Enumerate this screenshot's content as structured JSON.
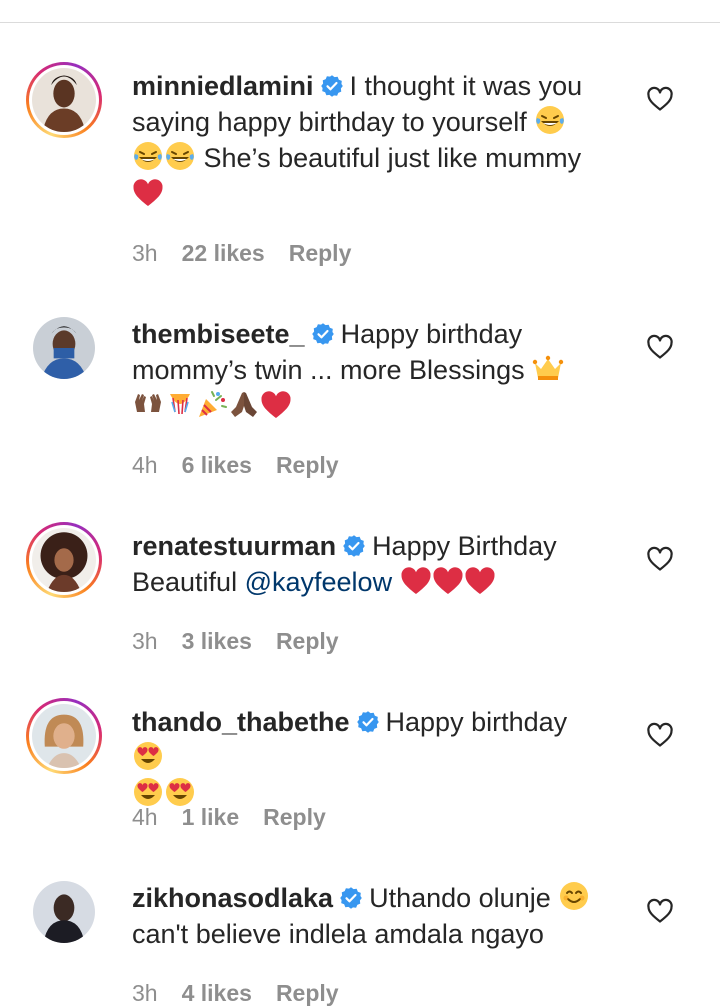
{
  "comments": [
    {
      "username": "minniedlamini",
      "verified": true,
      "text": [
        "I thought it was you",
        "saying happy birthday to yourself",
        "She’s beautiful just like mummy"
      ],
      "emojis": [
        "face-with-tears-of-joy",
        "face-with-tears-of-joy",
        "face-with-tears-of-joy",
        "red-heart"
      ],
      "time": "3h",
      "likes": "22 likes",
      "reply": "Reply"
    },
    {
      "username": "thembiseete_",
      "verified": true,
      "text": [
        "Happy birthday",
        "mommy’s twin ... more Blessings"
      ],
      "emojis": [
        "crown",
        "raising-hands",
        "confetti-ball",
        "party-popper",
        "folded-hands",
        "red-heart"
      ],
      "time": "4h",
      "likes": "6 likes",
      "reply": "Reply"
    },
    {
      "username": "renatestuurman",
      "verified": true,
      "text": [
        "Happy Birthday",
        "Beautiful"
      ],
      "mention": "@kayfeelow",
      "emojis": [
        "red-heart",
        "red-heart",
        "red-heart"
      ],
      "time": "3h",
      "likes": "3 likes",
      "reply": "Reply"
    },
    {
      "username": "thando_thabethe",
      "verified": true,
      "text": [
        "Happy birthday"
      ],
      "emojis": [
        "heart-eyes",
        "heart-eyes",
        "heart-eyes"
      ],
      "time": "4h",
      "likes": "1 like",
      "reply": "Reply"
    },
    {
      "username": "zikhonasodlaka",
      "verified": true,
      "text": [
        "Uthando olunje",
        "can't believe indlela amdala ngayo"
      ],
      "emojis": [
        "smiling-face"
      ],
      "time": "3h",
      "likes": "4 likes",
      "reply": "Reply"
    }
  ],
  "icons": {
    "verified": "verified-badge-icon",
    "like": "heart-outline-icon"
  },
  "colors": {
    "verified": "#3897f0",
    "link": "#00376b",
    "meta": "#8e8e8e",
    "text": "#262626",
    "heart": "#e0245e"
  }
}
